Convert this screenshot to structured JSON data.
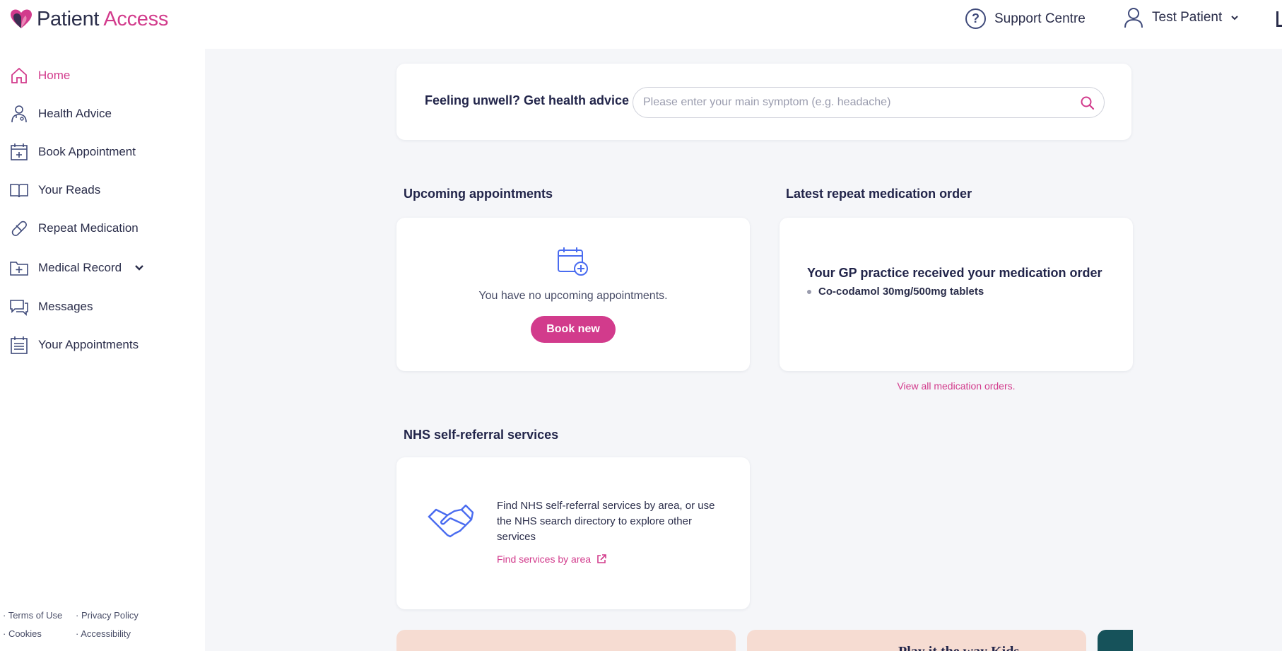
{
  "brand": {
    "name_part1": "Patient ",
    "name_part2": "Access",
    "primary_color": "#d23b8c",
    "navy_color": "#2a2d4a",
    "icon_color": "#4a6cf0"
  },
  "header": {
    "support_label": "Support Centre",
    "user_name": "Test Patient"
  },
  "sidebar": {
    "items": [
      {
        "label": "Home",
        "icon": "home-icon",
        "active": true
      },
      {
        "label": "Health Advice",
        "icon": "doctor-icon"
      },
      {
        "label": "Book Appointment",
        "icon": "calendar-plus-icon"
      },
      {
        "label": "Your Reads",
        "icon": "book-icon"
      },
      {
        "label": "Repeat Medication",
        "icon": "pill-icon"
      },
      {
        "label": "Medical Record",
        "icon": "medical-folder-icon",
        "expandable": true
      },
      {
        "label": "Messages",
        "icon": "messages-icon"
      },
      {
        "label": "Your Appointments",
        "icon": "appointments-list-icon"
      }
    ],
    "footer": {
      "terms": "· Terms of Use",
      "privacy": "· Privacy Policy",
      "cookies": "· Cookies",
      "accessibility": "· Accessibility"
    }
  },
  "health_advice": {
    "title": "Feeling unwell? Get health advice",
    "placeholder": "Please enter your main symptom (e.g. headache)",
    "value": ""
  },
  "appointments": {
    "section_title": "Upcoming appointments",
    "empty_text": "You have no upcoming appointments.",
    "book_label": "Book new"
  },
  "medication": {
    "section_title": "Latest repeat medication order",
    "status": "Your GP practice received your medication order",
    "items": [
      "Co-codamol 30mg/500mg tablets"
    ],
    "view_all": "View all medication orders."
  },
  "nhs": {
    "section_title": "NHS self-referral services",
    "description": "Find NHS self-referral services by area, or use the NHS search directory to explore other services",
    "link": "Find services by area"
  },
  "promos": {
    "second_partial_text": "Play it the way Kids"
  }
}
